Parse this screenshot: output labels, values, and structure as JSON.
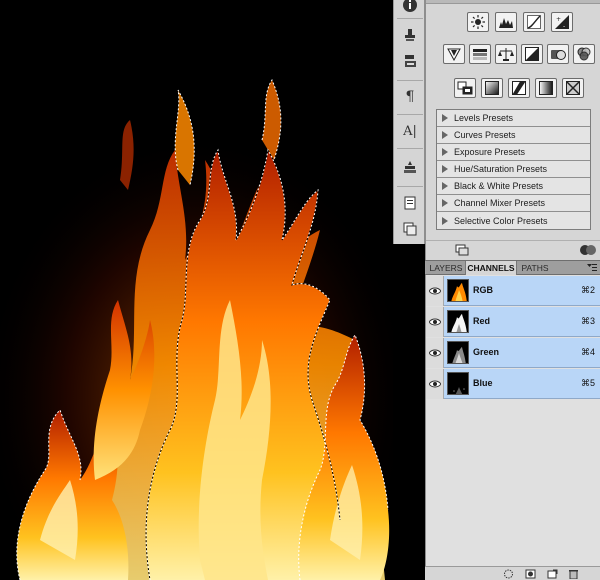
{
  "canvas": {
    "content": "fire-photo-with-selection"
  },
  "toolstrip": {
    "tools": [
      {
        "name": "info-icon"
      },
      {
        "name": "clone-source-icon"
      },
      {
        "name": "tool-presets-icon"
      },
      {
        "name": "paragraph-icon"
      },
      {
        "name": "character-icon"
      },
      {
        "name": "layer-comps-icon"
      },
      {
        "name": "notes-icon"
      },
      {
        "name": "layer-copy-icon"
      }
    ],
    "paragraph_glyph": "¶",
    "character_glyph": "A|"
  },
  "adjustments": {
    "row1": [
      "brightness-contrast-icon",
      "levels-icon",
      "curves-icon",
      "exposure-icon"
    ],
    "row2": [
      "vibrance-icon",
      "hue-saturation-icon",
      "color-balance-icon",
      "black-white-icon",
      "photo-filter-icon",
      "channel-mixer-icon"
    ],
    "row3": [
      "invert-icon",
      "posterize-icon",
      "threshold-icon",
      "gradient-map-icon",
      "selective-color-icon"
    ],
    "presets": [
      "Levels Presets",
      "Curves Presets",
      "Exposure Presets",
      "Hue/Saturation Presets",
      "Black & White Presets",
      "Channel Mixer Presets",
      "Selective Color Presets"
    ]
  },
  "tabs": [
    {
      "label": "LAYERS",
      "active": false
    },
    {
      "label": "CHANNELS",
      "active": true
    },
    {
      "label": "PATHS",
      "active": false
    }
  ],
  "channels": [
    {
      "name": "RGB",
      "shortcut": "⌘2",
      "thumb": "color"
    },
    {
      "name": "Red",
      "shortcut": "⌘3",
      "thumb": "red"
    },
    {
      "name": "Green",
      "shortcut": "⌘4",
      "thumb": "green"
    },
    {
      "name": "Blue",
      "shortcut": "⌘5",
      "thumb": "blue"
    }
  ],
  "colors": {
    "selected_row": "#b9d6f7",
    "panel_bg": "#d6d6d6",
    "fire_core": "#ffd24a",
    "fire_mid": "#ff8a00",
    "fire_edge": "#c22a00"
  }
}
